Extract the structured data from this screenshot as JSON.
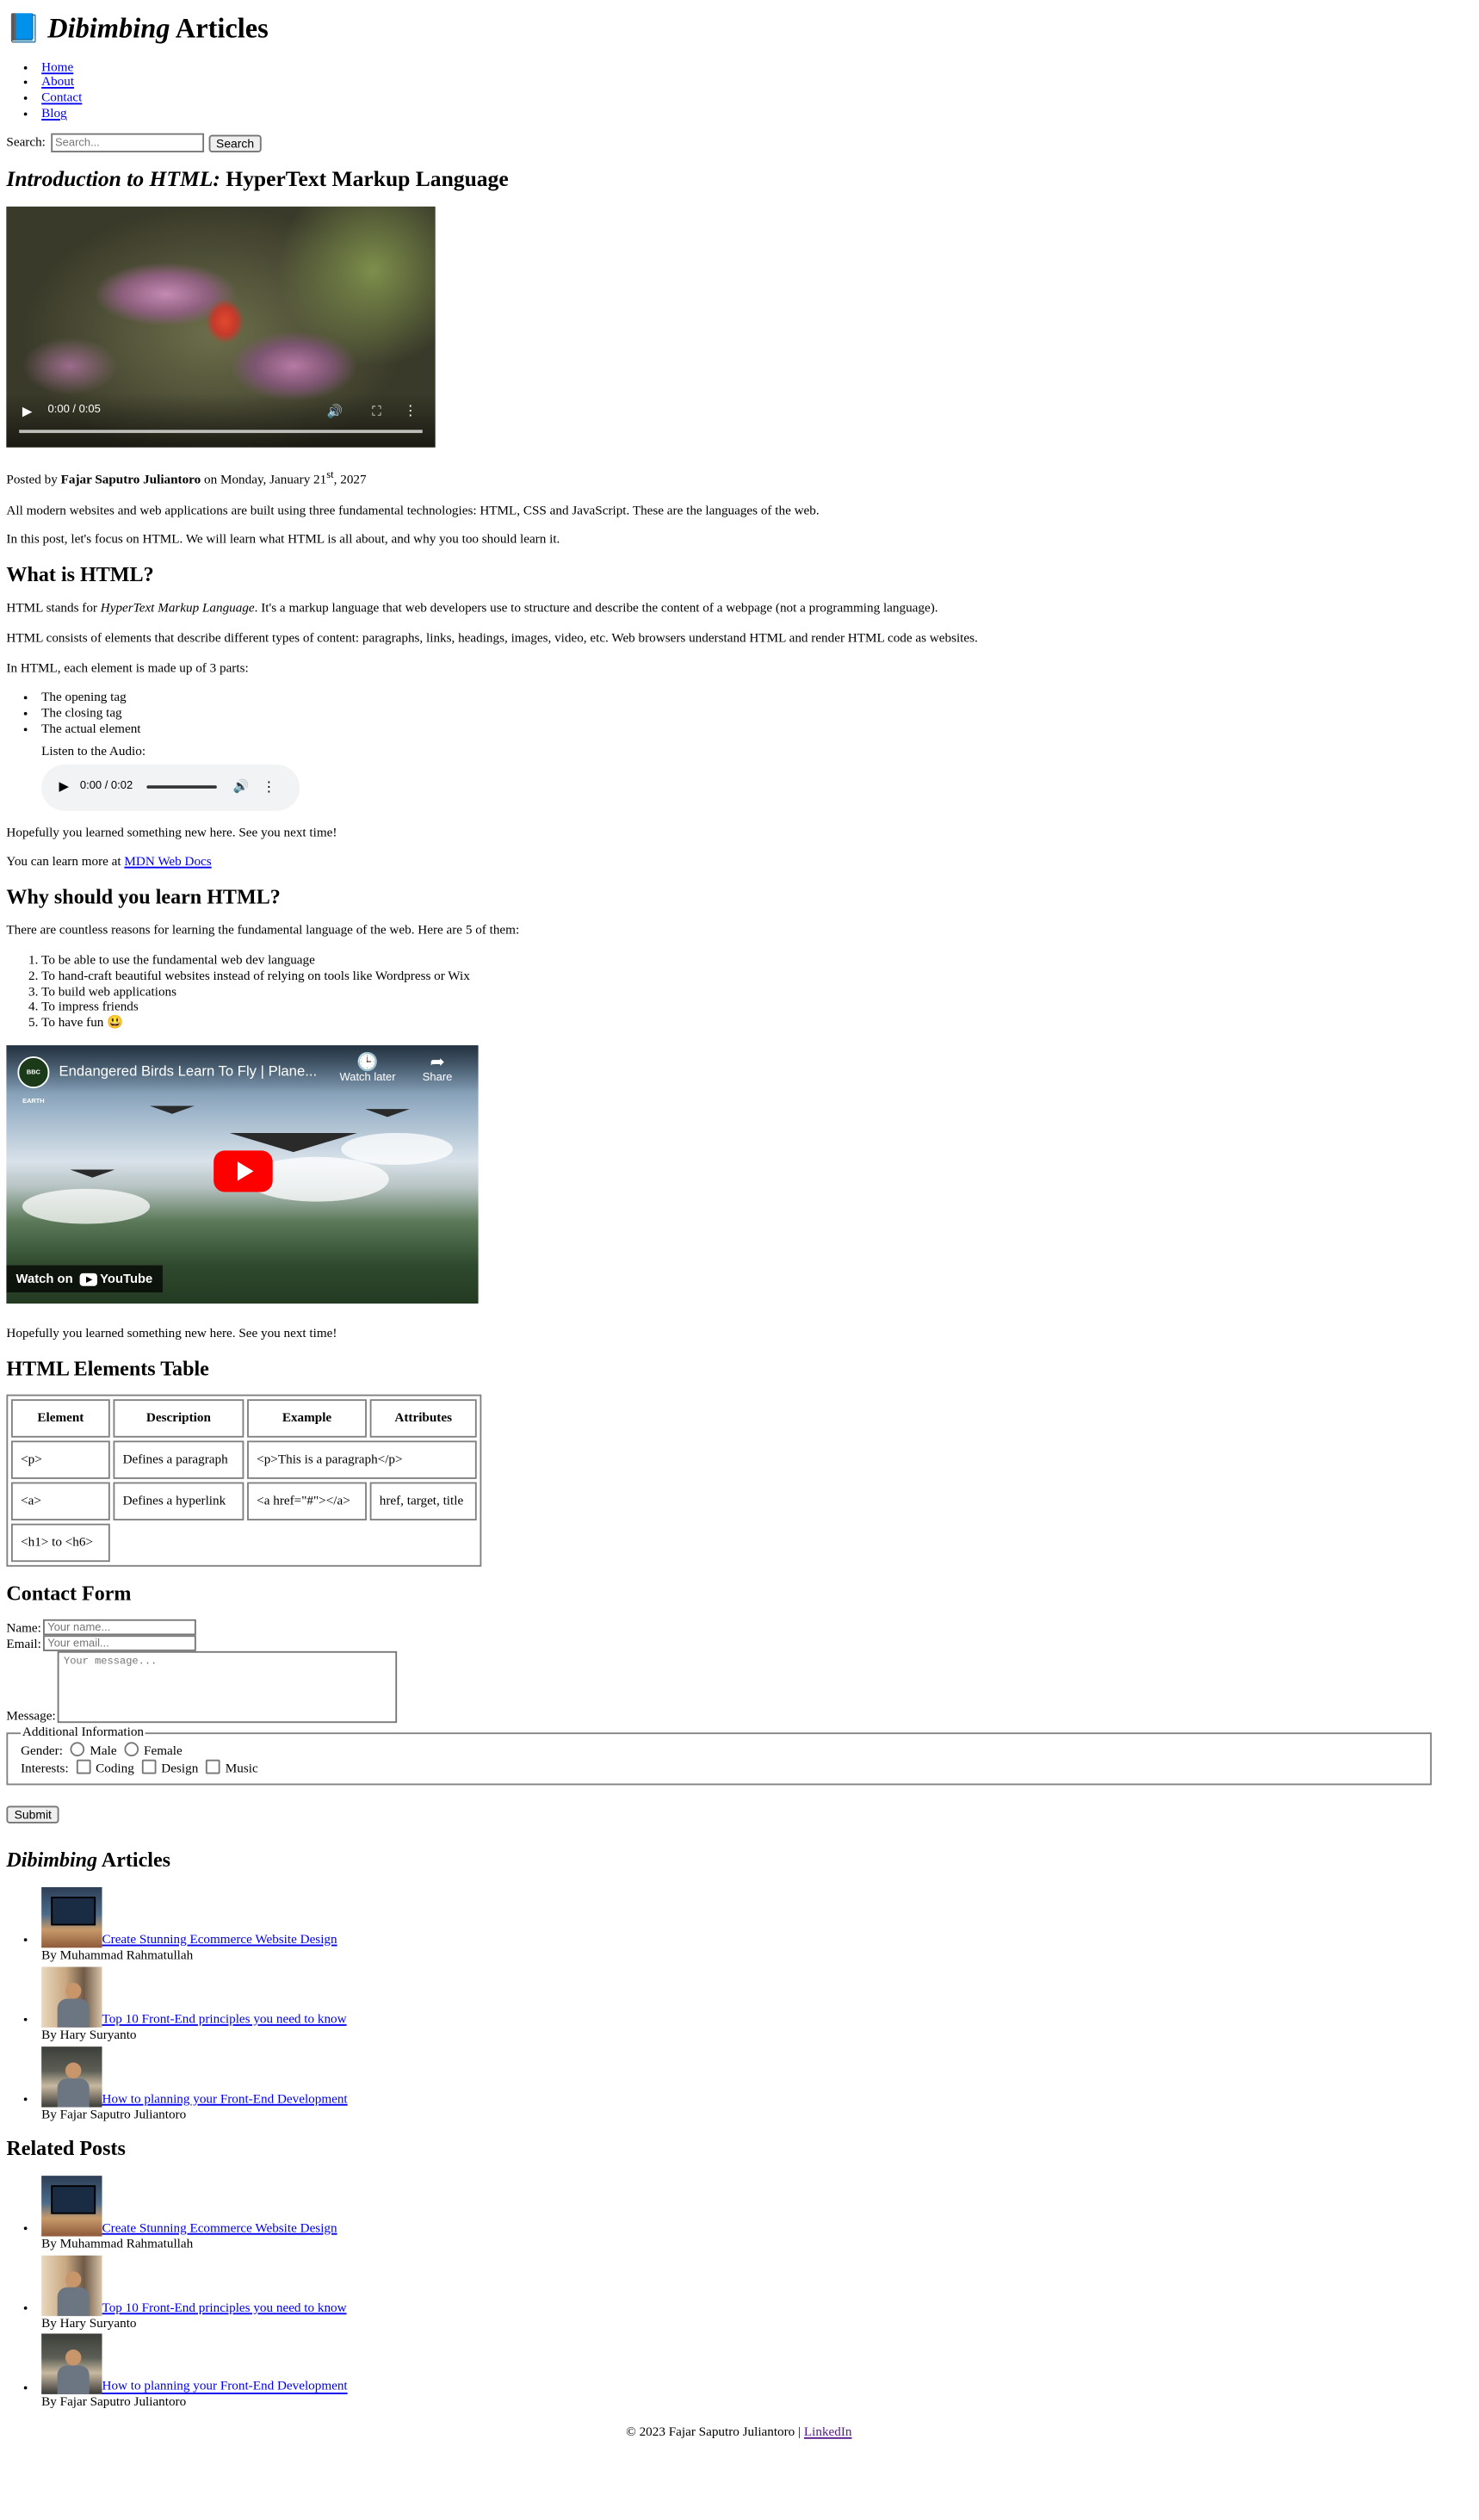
{
  "header": {
    "logo_emoji": "📘",
    "title_em": "Dibimbing",
    "title_rest": " Articles"
  },
  "nav": {
    "items": [
      {
        "label": "Home"
      },
      {
        "label": "About"
      },
      {
        "label": "Contact"
      },
      {
        "label": "Blog"
      }
    ]
  },
  "search": {
    "label": "Search:",
    "placeholder": "Search...",
    "button": "Search"
  },
  "article": {
    "title_em": "Introduction to HTML:",
    "title_rest": " HyperText Markup Language",
    "video": {
      "time": "0:00 / 0:05",
      "progress_fraction": 0
    },
    "posted_prefix": "Posted by ",
    "author": "Fajar Saputro Juliantoro",
    "posted_mid": " on Monday, January 21",
    "date_sup": "st",
    "posted_year": ", 2027",
    "intro1": "All modern websites and web applications are built using three fundamental technologies: HTML, CSS and JavaScript. These are the languages of the web.",
    "intro2": "In this post, let's focus on HTML. We will learn what HTML is all about, and why you too should learn it.",
    "what_heading": "What is HTML?",
    "what_p1_prefix": "HTML stands for ",
    "what_p1_em": "HyperText Markup Language",
    "what_p1_rest": ". It's a markup language that web developers use to structure and describe the content of a webpage (not a programming language).",
    "what_p2": "HTML consists of elements that describe different types of content: paragraphs, links, headings, images, video, etc. Web browsers understand HTML and render HTML code as websites.",
    "what_p3": "In HTML, each element is made up of 3 parts:",
    "parts": [
      "The opening tag",
      "The closing tag",
      "The actual element"
    ],
    "audio_label": "Listen to the Audio:",
    "audio_time": "0:00 / 0:02",
    "hope1": "Hopefully you learned something new here. See you next time!",
    "learn_more_prefix": "You can learn more at ",
    "learn_more_link": "MDN Web Docs",
    "why_heading": "Why should you learn HTML?",
    "why_p": "There are countless reasons for learning the fundamental language of the web. Here are 5 of them:",
    "reasons": [
      "To be able to use the fundamental web dev language",
      "To hand-craft beautiful websites instead of relying on tools like Wordpress or Wix",
      "To build web applications",
      "To impress friends",
      "To have fun 😃"
    ],
    "youtube": {
      "channel_badge": "BBC EARTH",
      "title": "Endangered Birds Learn To Fly | Plane...",
      "watch_later": "Watch later",
      "share": "Share",
      "watch_on": "Watch on",
      "youtube_label": "YouTube"
    },
    "hope2": "Hopefully you learned something new here. See you next time!"
  },
  "table_section": {
    "heading": "HTML Elements Table",
    "headers": [
      "Element",
      "Description",
      "Example",
      "Attributes"
    ],
    "rows": [
      [
        "<p>",
        "Defines a paragraph",
        "<p>This is a paragraph</p>",
        ""
      ],
      [
        "<a>",
        "Defines a hyperlink",
        "<a href=\"#\"></a>",
        "href, target, title"
      ],
      [
        "<h1> to <h6>",
        "",
        "",
        ""
      ]
    ]
  },
  "contact": {
    "heading": "Contact Form",
    "name_label": "Name:",
    "name_placeholder": "Your name...",
    "email_label": "Email:",
    "email_placeholder": "Your email...",
    "message_label": "Message:",
    "message_placeholder": "Your message...",
    "fieldset_legend": "Additional Information",
    "gender_label": "Gender:",
    "genders": [
      "Male",
      "Female"
    ],
    "interests_label": "Interests:",
    "interests": [
      "Coding",
      "Design",
      "Music"
    ],
    "submit": "Submit"
  },
  "articles_section": {
    "heading_em": "Dibimbing",
    "heading_rest": " Articles",
    "items": [
      {
        "title": "Create Stunning Ecommerce Website Design",
        "author": "By Muhammad Rahmatullah"
      },
      {
        "title": "Top 10 Front-End principles you need to know",
        "author": "By Hary Suryanto"
      },
      {
        "title": "How to planning your Front-End Development",
        "author": "By Fajar Saputro Juliantoro"
      }
    ]
  },
  "related_section": {
    "heading": "Related Posts",
    "items": [
      {
        "title": "Create Stunning Ecommerce Website Design",
        "author": "By Muhammad Rahmatullah"
      },
      {
        "title": "Top 10 Front-End principles you need to know",
        "author": "By Hary Suryanto"
      },
      {
        "title": "How to planning your Front-End Development",
        "author": "By Fajar Saputro Juliantoro"
      }
    ]
  },
  "footer": {
    "copyright": "© 2023 Fajar Saputro Juliantoro | ",
    "link": "LinkedIn"
  }
}
